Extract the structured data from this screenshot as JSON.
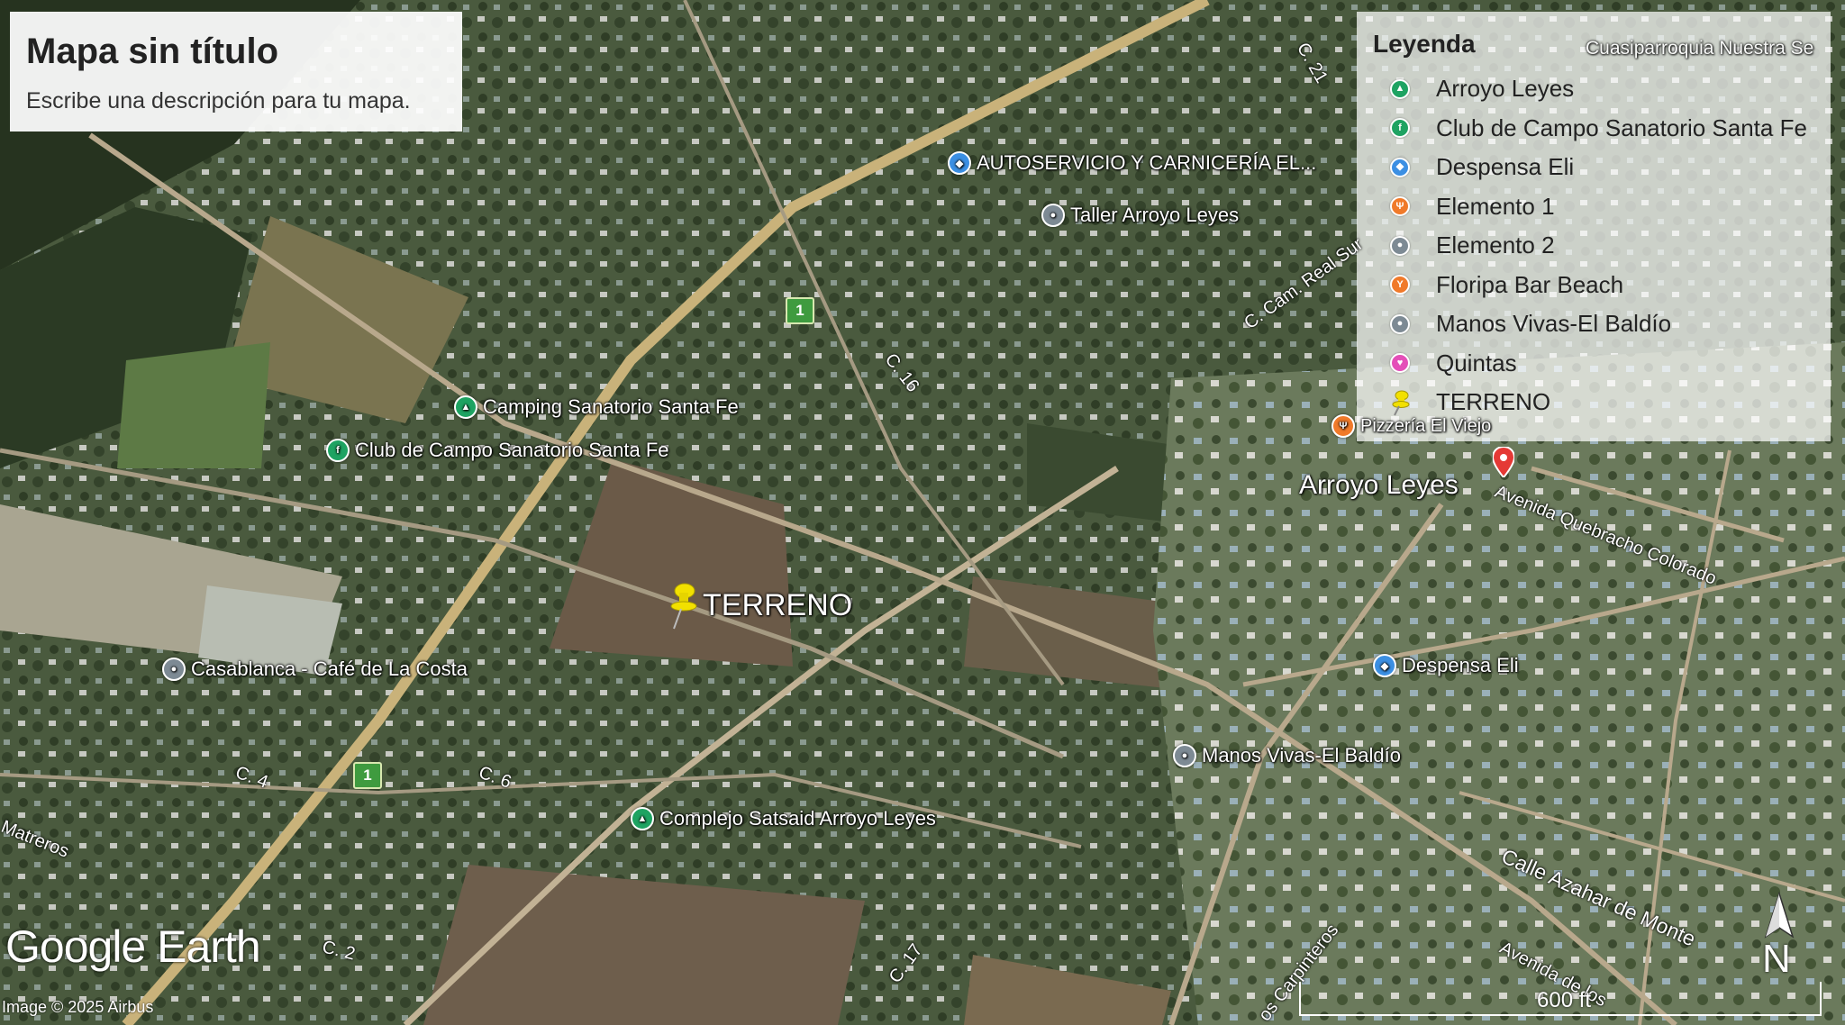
{
  "map": {
    "title": "Mapa sin título",
    "description": "Escribe una descripción para tu mapa.",
    "legend": {
      "heading": "Leyenda",
      "items": [
        {
          "label": "Arroyo Leyes",
          "icon": "triangle-icon",
          "color": "#1ea362",
          "glyph": "▲"
        },
        {
          "label": "Club de Campo Sanatorio Santa Fe",
          "icon": "flag-icon",
          "color": "#1ea362",
          "glyph": "f"
        },
        {
          "label": "Despensa Eli",
          "icon": "shopping-icon",
          "color": "#3b8fe3",
          "glyph": "◆"
        },
        {
          "label": "Elemento 1",
          "icon": "fork-icon",
          "color": "#f07a2a",
          "glyph": "Ψ"
        },
        {
          "label": "Elemento 2",
          "icon": "circle-icon",
          "color": "#7d8a94",
          "glyph": "●"
        },
        {
          "label": "Floripa Bar Beach",
          "icon": "glass-icon",
          "color": "#f07a2a",
          "glyph": "Y"
        },
        {
          "label": "Manos Vivas-El Baldío",
          "icon": "circle-icon",
          "color": "#7d8a94",
          "glyph": "●"
        },
        {
          "label": "Quintas",
          "icon": "heart-icon",
          "color": "#e44fb8",
          "glyph": "♥"
        },
        {
          "label": "TERRENO",
          "icon": "pushpin-icon",
          "color": "#f2e000",
          "glyph": ""
        }
      ]
    },
    "places": {
      "autoservicio": "AUTOSERVICIO Y CARNICERÍA EL...",
      "taller": "Taller Arroyo Leyes",
      "camping": "Camping Sanatorio Santa Fe",
      "club": "Club de Campo Sanatorio Santa Fe",
      "terreno": "TERRENO",
      "casablanca": "Casablanca - Café de La Costa",
      "complejo": "Complejo Satsaid Arroyo Leyes",
      "despensa": "Despensa Eli",
      "manos": "Manos Vivas-El Baldío",
      "pizzeria": "Pizzería El Viejo",
      "arroyo": "Arroyo Leyes",
      "cuasi": "Cuasiparroquia Nuestra Se"
    },
    "streets": {
      "c21": "C. 21",
      "c16": "C. 16",
      "c4": "C. 4",
      "c6": "C. 6",
      "c2": "C. 2",
      "c17": "C. 17",
      "camreal": "C. Cam. Real Sur",
      "quebracho": "Avenida Quebracho Colorado",
      "azahar": "Calle Azahar de Monte",
      "carpinteros": "os Carpinteros",
      "avenidabottom": "Avenida de los",
      "matreros": "Matreros"
    },
    "route_number": "1",
    "branding": "Google Earth",
    "copyright": "Image © 2025 Airbus",
    "scale_label": "600 ft",
    "north_label": "N"
  }
}
